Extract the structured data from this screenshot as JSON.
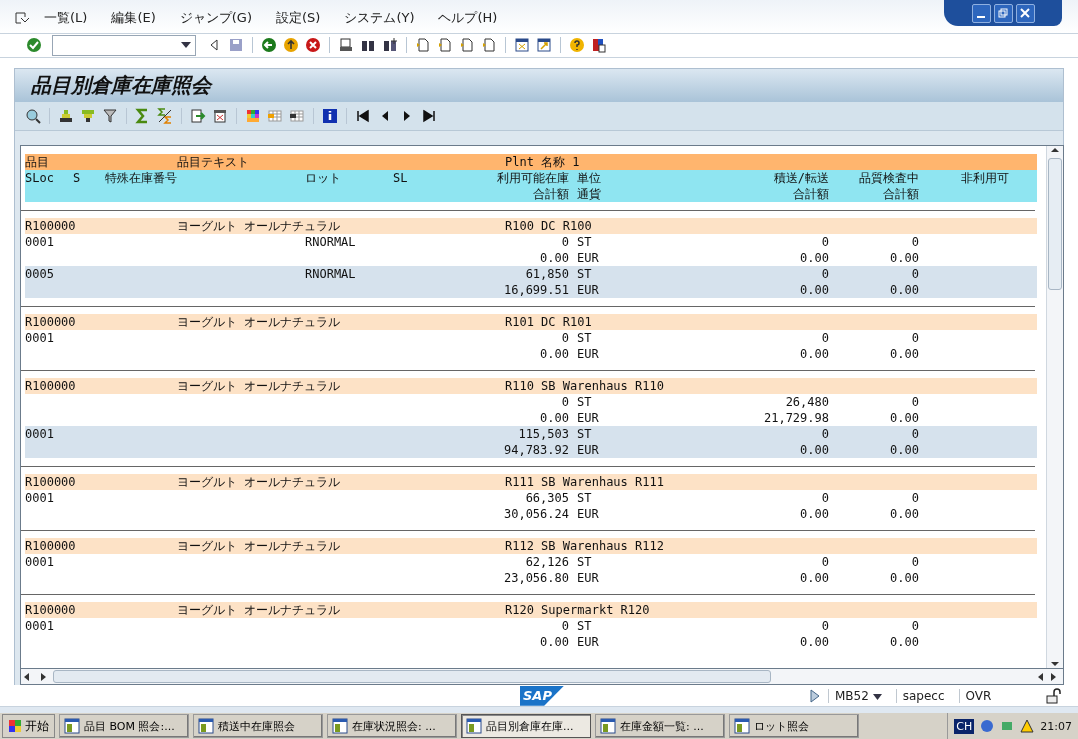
{
  "menu": [
    "一覧(L)",
    "編集(E)",
    "ジャンプ(G)",
    "設定(S)",
    "システム(Y)",
    "ヘルプ(H)"
  ],
  "title": "品目別倉庫在庫照会",
  "header": {
    "row1": {
      "material": "品目",
      "text": "品目テキスト",
      "plant": "Plnt 名称 1"
    },
    "row2": {
      "sloc": "SLoc",
      "s": "S",
      "special": "特殊在庫番号",
      "lot": "ロット",
      "sl": "SL",
      "qty": "利用可能在庫",
      "unit": "単位",
      "transit": "積送/転送",
      "quality": "品質検査中",
      "blocked": "非利用可"
    },
    "row3": {
      "qty": "合計額",
      "unit": "通貨",
      "transit": "合計額",
      "quality": "合計額"
    }
  },
  "groups": [
    {
      "material": "R100000",
      "text": "ヨーグルト オールナチュラル",
      "plant": "R100 DC R100",
      "lines": [
        {
          "sloc": "0001",
          "lot": "RNORMAL",
          "qty": "0",
          "unit": "ST",
          "transit": "0",
          "quality": "0",
          "shaded": false
        },
        {
          "qty": "0.00",
          "unit": "EUR",
          "transit": "0.00",
          "quality": "0.00",
          "shaded": false
        },
        {
          "sloc": "0005",
          "lot": "RNORMAL",
          "qty": "61,850",
          "unit": "ST",
          "transit": "0",
          "quality": "0",
          "shaded": true
        },
        {
          "qty": "16,699.51",
          "unit": "EUR",
          "transit": "0.00",
          "quality": "0.00",
          "shaded": true
        }
      ]
    },
    {
      "material": "R100000",
      "text": "ヨーグルト オールナチュラル",
      "plant": "R101 DC R101",
      "lines": [
        {
          "sloc": "0001",
          "qty": "0",
          "unit": "ST",
          "transit": "0",
          "quality": "0",
          "shaded": false
        },
        {
          "qty": "0.00",
          "unit": "EUR",
          "transit": "0.00",
          "quality": "0.00",
          "shaded": false
        }
      ]
    },
    {
      "material": "R100000",
      "text": "ヨーグルト オールナチュラル",
      "plant": "R110 SB Warenhaus R110",
      "lines": [
        {
          "qty": "0",
          "unit": "ST",
          "transit": "26,480",
          "quality": "0",
          "shaded": false
        },
        {
          "qty": "0.00",
          "unit": "EUR",
          "transit": "21,729.98",
          "quality": "0.00",
          "shaded": false
        },
        {
          "sloc": "0001",
          "qty": "115,503",
          "unit": "ST",
          "transit": "0",
          "quality": "0",
          "shaded": true
        },
        {
          "qty": "94,783.92",
          "unit": "EUR",
          "transit": "0.00",
          "quality": "0.00",
          "shaded": true
        }
      ]
    },
    {
      "material": "R100000",
      "text": "ヨーグルト オールナチュラル",
      "plant": "R111 SB Warenhaus R111",
      "lines": [
        {
          "sloc": "0001",
          "qty": "66,305",
          "unit": "ST",
          "transit": "0",
          "quality": "0",
          "shaded": false
        },
        {
          "qty": "30,056.24",
          "unit": "EUR",
          "transit": "0.00",
          "quality": "0.00",
          "shaded": false
        }
      ]
    },
    {
      "material": "R100000",
      "text": "ヨーグルト オールナチュラル",
      "plant": "R112 SB Warenhaus R112",
      "lines": [
        {
          "sloc": "0001",
          "qty": "62,126",
          "unit": "ST",
          "transit": "0",
          "quality": "0",
          "shaded": false
        },
        {
          "qty": "23,056.80",
          "unit": "EUR",
          "transit": "0.00",
          "quality": "0.00",
          "shaded": false
        }
      ]
    },
    {
      "material": "R100000",
      "text": "ヨーグルト オールナチュラル",
      "plant": "R120 Supermarkt R120",
      "lines": [
        {
          "sloc": "0001",
          "qty": "0",
          "unit": "ST",
          "transit": "0",
          "quality": "0",
          "shaded": false
        },
        {
          "qty": "0.00",
          "unit": "EUR",
          "transit": "0.00",
          "quality": "0.00",
          "shaded": false
        }
      ]
    }
  ],
  "status": {
    "logo": "SAP",
    "transaction": "MB52",
    "system": "sapecc",
    "mode": "OVR"
  },
  "taskbar": {
    "start": "开始",
    "items": [
      {
        "label": "品目 BOM 照会:...",
        "selected": false
      },
      {
        "label": "積送中在庫照会",
        "selected": false
      },
      {
        "label": "在庫状況照会: ...",
        "selected": false
      },
      {
        "label": "品目別倉庫在庫...",
        "selected": true
      },
      {
        "label": "在庫金額一覧: ...",
        "selected": false
      },
      {
        "label": "ロット照会",
        "selected": false
      }
    ],
    "language": "CH",
    "time": "21:07"
  }
}
